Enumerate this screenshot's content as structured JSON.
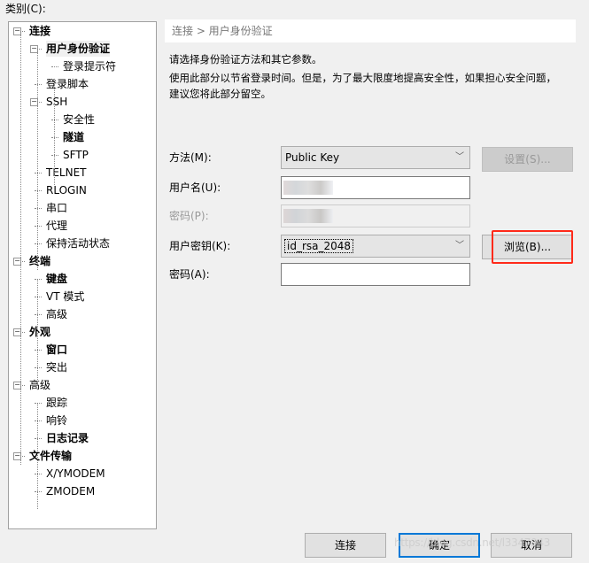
{
  "category_label": "类别(C):",
  "tree": [
    {
      "label": "连接",
      "level": 0,
      "bold": true,
      "expander": true
    },
    {
      "label": "用户身份验证",
      "level": 1,
      "bold": true,
      "expander": true,
      "selected": true
    },
    {
      "label": "登录提示符",
      "level": 2
    },
    {
      "label": "登录脚本",
      "level": 1
    },
    {
      "label": "SSH",
      "level": 1,
      "expander": true
    },
    {
      "label": "安全性",
      "level": 2
    },
    {
      "label": "隧道",
      "level": 2,
      "bold": true
    },
    {
      "label": "SFTP",
      "level": 2
    },
    {
      "label": "TELNET",
      "level": 1
    },
    {
      "label": "RLOGIN",
      "level": 1
    },
    {
      "label": "串口",
      "level": 1
    },
    {
      "label": "代理",
      "level": 1
    },
    {
      "label": "保持活动状态",
      "level": 1
    },
    {
      "label": "终端",
      "level": 0,
      "bold": true,
      "expander": true
    },
    {
      "label": "键盘",
      "level": 1,
      "bold": true
    },
    {
      "label": "VT 模式",
      "level": 1
    },
    {
      "label": "高级",
      "level": 1
    },
    {
      "label": "外观",
      "level": 0,
      "bold": true,
      "expander": true
    },
    {
      "label": "窗口",
      "level": 1,
      "bold": true
    },
    {
      "label": "突出",
      "level": 1
    },
    {
      "label": "高级",
      "level": 0,
      "expander": true
    },
    {
      "label": "跟踪",
      "level": 1
    },
    {
      "label": "响铃",
      "level": 1
    },
    {
      "label": "日志记录",
      "level": 1,
      "bold": true
    },
    {
      "label": "文件传输",
      "level": 0,
      "bold": true,
      "expander": true
    },
    {
      "label": "X/YMODEM",
      "level": 1
    },
    {
      "label": "ZMODEM",
      "level": 1
    }
  ],
  "breadcrumb": "连接 > 用户身份验证",
  "desc1": "请选择身份验证方法和其它参数。",
  "desc2": "使用此部分以节省登录时间。但是，为了最大限度地提高安全性，如果担心安全问题，",
  "desc3": "建议您将此部分留空。",
  "form": {
    "method_label": "方法(M):",
    "method_value": "Public Key",
    "settings_button": "设置(S)...",
    "username_label": "用户名(U):",
    "password_label": "密码(P):",
    "userkey_label": "用户密钥(K):",
    "userkey_value": "id_rsa_2048",
    "browse_button": "浏览(B)...",
    "passphrase_label": "密码(A):"
  },
  "buttons": {
    "connect": "连接",
    "ok": "确定",
    "cancel": "取消"
  },
  "watermark": "https://blog.csdn.net/l3347943",
  "highlight_color": "#ff2a1a"
}
